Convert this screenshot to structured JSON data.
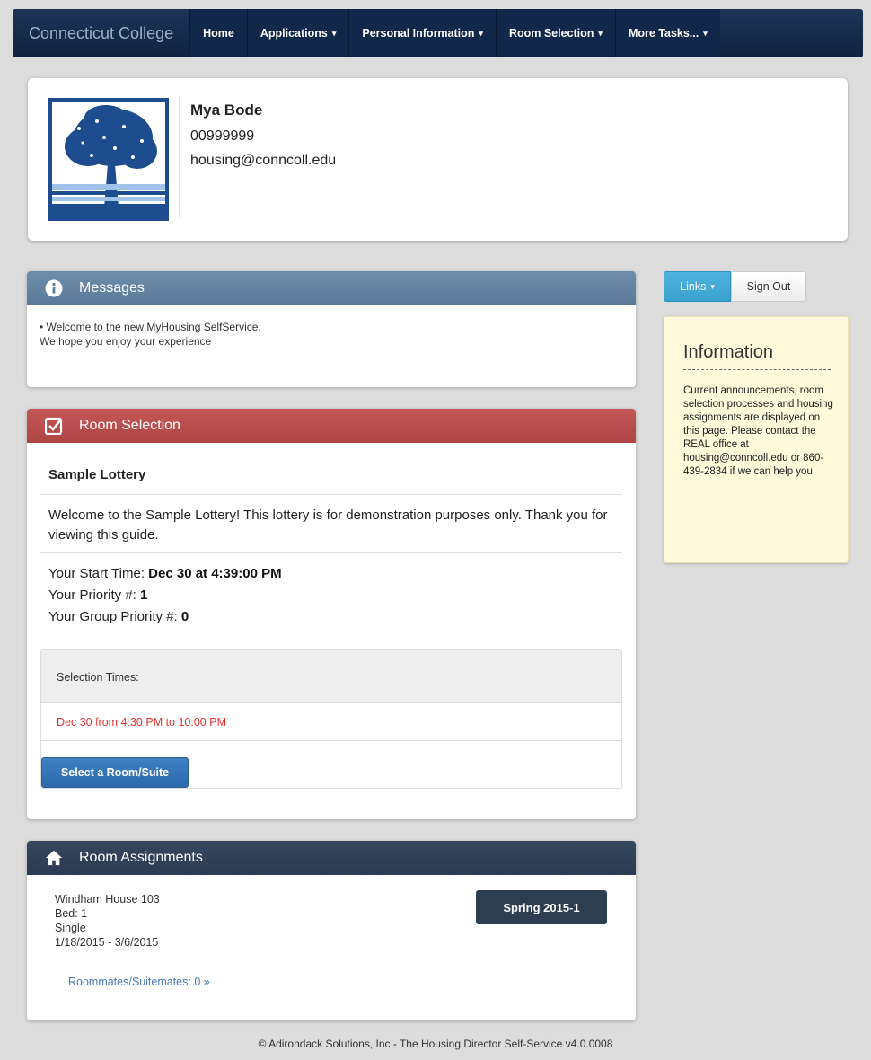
{
  "nav": {
    "brand": "Connecticut College",
    "items": [
      {
        "label": "Home"
      },
      {
        "label": "Applications",
        "caret": "▾"
      },
      {
        "label": "Personal Information",
        "caret": "▾"
      },
      {
        "label": "Room Selection",
        "caret": "▾"
      },
      {
        "label": "More Tasks...",
        "caret": "▾"
      }
    ]
  },
  "profile": {
    "name": "Mya Bode",
    "id": "00999999",
    "email": "housing@conncoll.edu"
  },
  "messages": {
    "title": "Messages",
    "line1": "• Welcome to the new MyHousing SelfService.",
    "line2": "We hope you enjoy your experience"
  },
  "room_selection": {
    "title": "Room Selection",
    "lottery_name": "Sample Lottery",
    "description": "Welcome to the Sample Lottery! This lottery is for demonstration purposes only. Thank you for viewing this guide.",
    "start_time_label": "Your Start Time:",
    "start_time_value": "Dec 30 at 4:39:00 PM",
    "priority_label": "Your Priority #:",
    "priority_value": "1",
    "group_priority_label": "Your Group Priority #:",
    "group_priority_value": "0",
    "selection_times_label": "Selection Times:",
    "selection_time": "Dec 30 from 4:30 PM to 10:00 PM",
    "select_button": "Select a Room/Suite"
  },
  "room_assignments": {
    "title": "Room Assignments",
    "building": "Windham House 103",
    "bed": "Bed: 1",
    "type": "Single",
    "dates": "1/18/2015 - 3/6/2015",
    "roommates_link": "Roommates/Suitemates: 0 »",
    "term_button": "Spring 2015-1"
  },
  "sidebar": {
    "links_label": "Links",
    "links_caret": "▾",
    "signout_label": "Sign Out",
    "info_title": "Information",
    "info_text": "Current announcements, room selection processes and housing assignments are displayed on this page. Please contact the REAL office at housing@conncoll.edu or 860-439-2834 if we can help you."
  },
  "footer": "© Adirondack Solutions, Inc - The Housing Director Self-Service v4.0.0008",
  "colors": {
    "navbar": "#12284a",
    "messages_header": "#5a7998",
    "room_selection_header": "#b04545",
    "room_assign_header": "#2a3b52",
    "primary_button": "#2c6aac",
    "links_button": "#3aa1cf",
    "alert_text": "#e83030",
    "info_bg": "#fffadb"
  }
}
